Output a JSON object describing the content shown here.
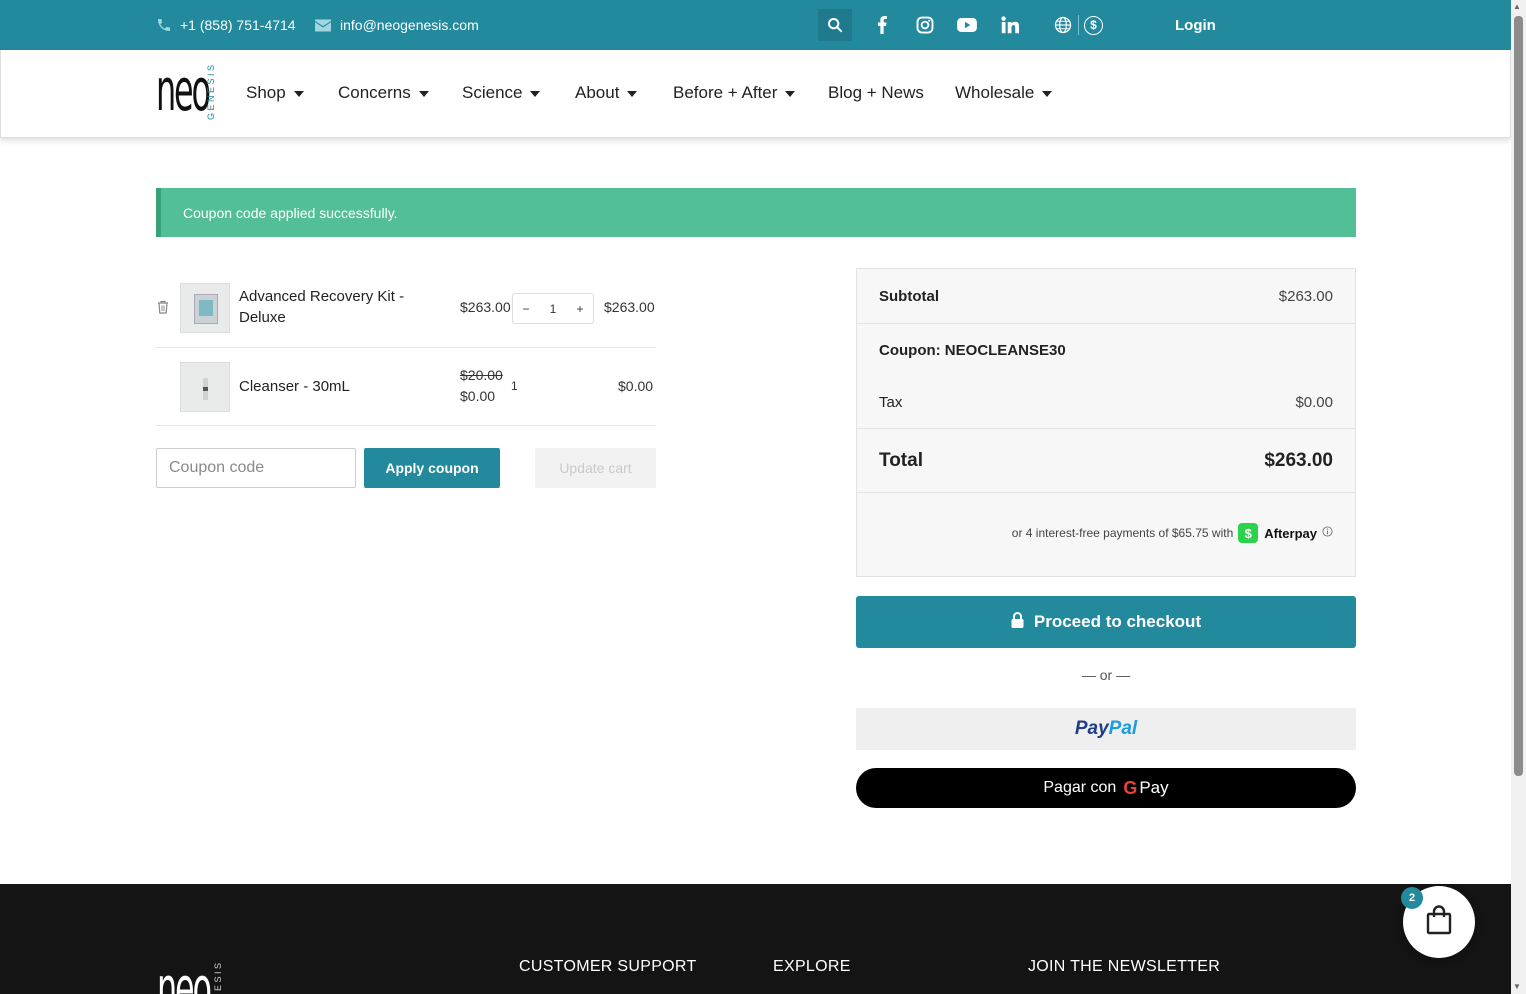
{
  "topbar": {
    "phone": "+1 (858) 751-4714",
    "email": "info@neogenesis.com",
    "login": "Login",
    "icons": [
      "phone-icon",
      "mail-icon",
      "search-icon",
      "facebook-icon",
      "instagram-icon",
      "youtube-icon",
      "linkedin-icon",
      "globe-icon",
      "currency-icon"
    ],
    "currency_symbol": "$"
  },
  "logo": {
    "main": "neo",
    "side": "GENESIS"
  },
  "nav": [
    {
      "label": "Shop",
      "dropdown": true
    },
    {
      "label": "Concerns",
      "dropdown": true
    },
    {
      "label": "Science",
      "dropdown": true
    },
    {
      "label": "About",
      "dropdown": true
    },
    {
      "label": "Before + After",
      "dropdown": true
    },
    {
      "label": "Blog + News",
      "dropdown": false
    },
    {
      "label": "Wholesale",
      "dropdown": true
    }
  ],
  "notice": "Coupon code applied successfully.",
  "cart": {
    "items": [
      {
        "name_line1": "Advanced Recovery Kit -",
        "name_line2": "Deluxe",
        "price": "$263.00",
        "quantity": "1",
        "subtotal": "$263.00"
      },
      {
        "name": "Cleanser - 30mL",
        "old_price": "$20.00",
        "price": "$0.00",
        "quantity": "1",
        "subtotal": "$0.00"
      }
    ],
    "qty_minus": "−",
    "qty_plus": "+",
    "coupon_placeholder": "Coupon code",
    "apply_coupon": "Apply coupon",
    "update_cart": "Update cart"
  },
  "totals": {
    "subtotal_label": "Subtotal",
    "subtotal_value": "$263.00",
    "coupon_label": "Coupon: NEOCLEANSE30",
    "tax_label": "Tax",
    "tax_value": "$0.00",
    "total_label": "Total",
    "total_value": "$263.00",
    "afterpay_text": "or 4 interest-free payments of $65.75 with",
    "afterpay_brand": "Afterpay",
    "afterpay_badge": "$"
  },
  "checkout": {
    "proceed": "Proceed to checkout",
    "or": "— or —",
    "paypal_pay": "Pay",
    "paypal_pal": "Pal",
    "gpay_text": "Pagar con",
    "gpay_g": "G",
    "gpay_pay": "Pay"
  },
  "footer": {
    "logo_main": "neo",
    "logo_side": "GENESIS",
    "headings": [
      "CUSTOMER SUPPORT",
      "EXPLORE",
      "JOIN THE NEWSLETTER"
    ]
  },
  "floating_cart": {
    "count": "2"
  },
  "colors": {
    "primary": "#23899d",
    "notice": "#52bf96",
    "footer": "#141414",
    "afterpay": "#2bd34a"
  }
}
